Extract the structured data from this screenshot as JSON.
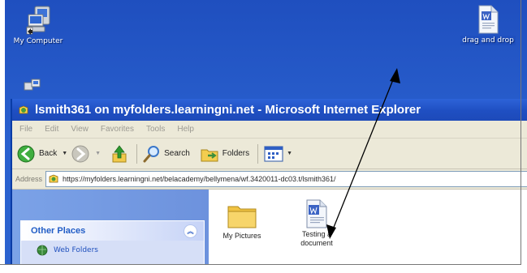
{
  "desktop": {
    "icons": [
      {
        "name": "my-computer",
        "label": "My Computer",
        "icon": "computer-icon"
      },
      {
        "name": "drag-and-drop",
        "label": "drag and drop",
        "icon": "word-document-icon"
      }
    ]
  },
  "window": {
    "title": "lsmith361 on myfolders.learningni.net - Microsoft Internet Explorer",
    "menu": [
      "File",
      "Edit",
      "View",
      "Favorites",
      "Tools",
      "Help"
    ],
    "toolbar": {
      "back": "Back",
      "search": "Search",
      "folders": "Folders"
    },
    "address": {
      "label": "Address",
      "url": "https://myfolders.learningni.net/belacademy/bellymena/wf.3420011-dc03.t/lsmith361/"
    }
  },
  "sidebar": {
    "panel_title": "Other Places",
    "items": [
      {
        "label": "Web Folders"
      }
    ]
  },
  "files": [
    {
      "label": "My Pictures",
      "icon": "folder-icon"
    },
    {
      "label": "Testing a document",
      "icon": "word-document-icon"
    }
  ],
  "colors": {
    "desktop": "#2a61cf",
    "titlebar": "#1f4fc2",
    "panel_header_text": "#215dc6",
    "window_bg": "#ece9d8"
  }
}
